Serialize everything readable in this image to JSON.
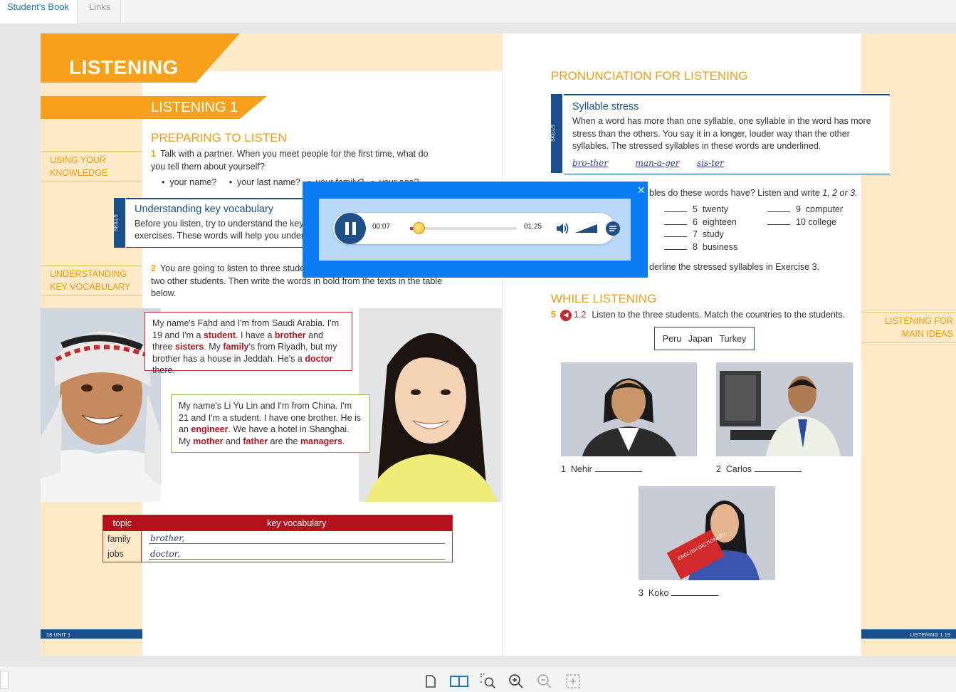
{
  "tabs": [
    {
      "label": "Student's Book"
    },
    {
      "label": "Links"
    }
  ],
  "left_page": {
    "banner": "LISTENING",
    "sub_banner": "LISTENING 1",
    "preparing_title": "PREPARING TO LISTEN",
    "side_labels": {
      "using": "USING YOUR KNOWLEDGE",
      "vocab": "UNDERSTANDING KEY VOCABULARY"
    },
    "ex1_num": "1",
    "ex1_text": "Talk with a partner. When you meet people for the first time, what do you tell them about yourself?",
    "ex1_bullet1": "your name?",
    "ex1_bullet2": "your last name?",
    "ex1_bullet3": "your family?",
    "ex1_bullet4": "your age?",
    "skill_tab": "SKILLS",
    "skill_title": "Understanding key vocabulary",
    "skill_text": "Before you listen, try to understand the key vocabulary by doing exercises. These words will help you understand.",
    "ex2_num": "2",
    "ex2_text": "You are going to listen to three students. Before you listen, read about two other students. Then write the words in bold from the texts in the table below.",
    "fahd": {
      "t1": "My name's Fahd and I'm from Saudi Arabia. I'm 19 and I'm a ",
      "w1": "student",
      "t2": ". I have a ",
      "w2": "brother",
      "t3": " and three ",
      "w3": "sisters",
      "t4": ". My ",
      "w4": "family",
      "t5": "'s from Riyadh, but my brother has a house in Jeddah. He's a ",
      "w5": "doctor",
      "t6": " there."
    },
    "li": {
      "t1": "My name's Li Yu Lin and I'm from China. I'm 21 and I'm a student. I have one brother. He is an ",
      "w1": "engineer",
      "t2": ". We have a hotel in Shanghai. My ",
      "w2": "mother",
      "t3": " and ",
      "w3": "father",
      "t4": " are the ",
      "w4": "managers",
      "t5": "."
    },
    "table": {
      "headers": [
        "topic",
        "key vocabulary"
      ],
      "rows": [
        {
          "topic": "family",
          "vocab": "brother,"
        },
        {
          "topic": "jobs",
          "vocab": "doctor,"
        }
      ]
    },
    "footer": "18   UNIT 1"
  },
  "right_page": {
    "pron_title": "PRONUNCIATION FOR LISTENING",
    "skill_tab": "SKILLS",
    "syllable_title": "Syllable stress",
    "syllable_text": "When a word has more than one syllable, one syllable in the word has more stress than the others. You say it in a longer, louder way than the other syllables. The stressed syllables in these words are underlined.",
    "examples": [
      "bro-ther",
      "man-a-ger",
      "sis-ter"
    ],
    "ex3_tail": "bles do these words have? Listen and write ",
    "ex3_options": "1, 2 or 3.",
    "words_col1": [
      {
        "n": "5",
        "w": "twenty"
      },
      {
        "n": "6",
        "w": "eighteen"
      },
      {
        "n": "7",
        "w": "study"
      },
      {
        "n": "8",
        "w": "business"
      }
    ],
    "words_col2": [
      {
        "n": "9",
        "w": "computer"
      },
      {
        "n": "10",
        "w": "college"
      }
    ],
    "ex4_tail": "derline the stressed syllables in Exercise 3.",
    "while_title": "WHILE LISTENING",
    "ex5_num": "5",
    "ex5_track": "1.2",
    "ex5_text": "Listen to the three students. Match the countries to the students.",
    "countries": [
      "Peru",
      "Japan",
      "Turkey"
    ],
    "side_label": "LISTENING FOR MAIN IDEAS",
    "people": [
      {
        "n": "1",
        "name": "Nehir"
      },
      {
        "n": "2",
        "name": "Carlos"
      },
      {
        "n": "3",
        "name": "Koko"
      }
    ],
    "book_text": "ENGLISH DICTIONARY",
    "footer": "LISTENING 1   19"
  },
  "player": {
    "current_time": "00:07",
    "total_time": "01:25",
    "progress": 0.082,
    "close": "×"
  },
  "toolbar": {
    "icons": [
      "single-page-icon",
      "double-page-icon",
      "zoom-area-icon",
      "zoom-in-icon",
      "zoom-out-icon",
      "fit-page-icon"
    ]
  },
  "colors": {
    "accent_orange": "#f39c12",
    "navy": "#1a4f8b",
    "red": "#b5121b",
    "player_blue": "#0a7cf5"
  }
}
